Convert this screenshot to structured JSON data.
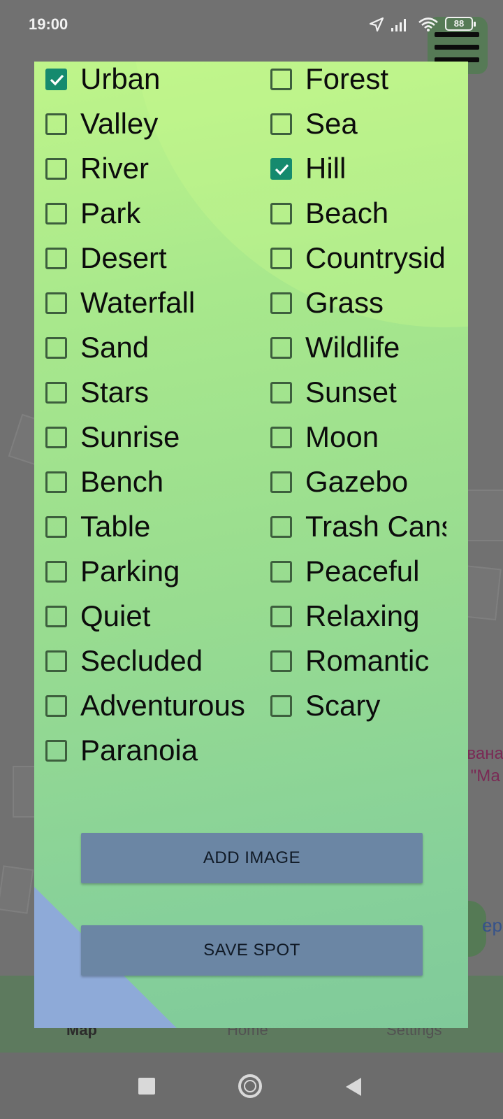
{
  "status_bar": {
    "time": "19:00",
    "battery": "88"
  },
  "background": {
    "bottom_nav": [
      "Map",
      "Home",
      "Settings"
    ],
    "map_text_lines": [
      "ивана",
      "s \"Ма"
    ],
    "fab_text": "ер"
  },
  "tags": {
    "left": [
      {
        "label": "Urban",
        "checked": true
      },
      {
        "label": "Valley",
        "checked": false
      },
      {
        "label": "River",
        "checked": false
      },
      {
        "label": "Park",
        "checked": false
      },
      {
        "label": "Desert",
        "checked": false
      },
      {
        "label": "Waterfall",
        "checked": false
      },
      {
        "label": "Sand",
        "checked": false
      },
      {
        "label": "Stars",
        "checked": false
      },
      {
        "label": "Sunrise",
        "checked": false
      },
      {
        "label": "Bench",
        "checked": false
      },
      {
        "label": "Table",
        "checked": false
      },
      {
        "label": "Parking",
        "checked": false
      },
      {
        "label": "Quiet",
        "checked": false
      },
      {
        "label": "Secluded",
        "checked": false
      },
      {
        "label": "Adventurous",
        "checked": false
      },
      {
        "label": "Paranoia",
        "checked": false
      }
    ],
    "right": [
      {
        "label": "Forest",
        "checked": false
      },
      {
        "label": "Sea",
        "checked": false
      },
      {
        "label": "Hill",
        "checked": true
      },
      {
        "label": "Beach",
        "checked": false
      },
      {
        "label": "Countryside",
        "checked": false
      },
      {
        "label": "Grass",
        "checked": false
      },
      {
        "label": "Wildlife",
        "checked": false
      },
      {
        "label": "Sunset",
        "checked": false
      },
      {
        "label": "Moon",
        "checked": false
      },
      {
        "label": "Gazebo",
        "checked": false
      },
      {
        "label": "Trash Cans",
        "checked": false
      },
      {
        "label": "Peaceful",
        "checked": false
      },
      {
        "label": "Relaxing",
        "checked": false
      },
      {
        "label": "Romantic",
        "checked": false
      },
      {
        "label": "Scary",
        "checked": false
      }
    ]
  },
  "buttons": {
    "add_image": "ADD IMAGE",
    "save_spot": "SAVE SPOT"
  },
  "colors": {
    "checkbox_checked": "#158a6e",
    "button_bg": "#6b86a4",
    "dialog_top": "#bff58a",
    "dialog_bottom": "#80ca9a"
  },
  "icons": [
    "location-arrow-icon",
    "signal-icon",
    "wifi-icon",
    "battery-icon",
    "menu-icon",
    "check-icon",
    "recents-icon",
    "home-circle-icon",
    "back-icon"
  ]
}
